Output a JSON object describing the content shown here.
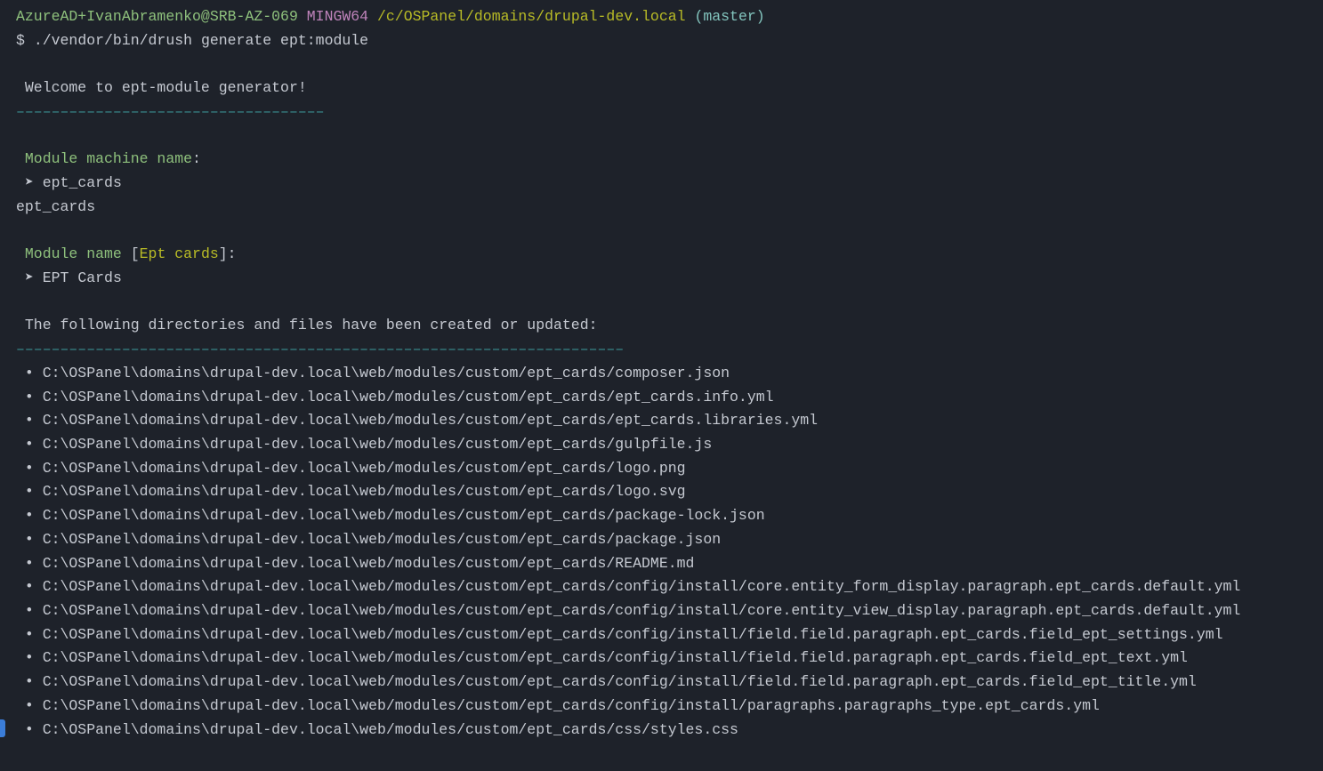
{
  "prompt": {
    "user_host": "AzureAD+IvanAbramenko@SRB-AZ-069",
    "shell": "MINGW64",
    "path": "/c/OSPanel/domains/drupal-dev.local",
    "branch": "(master)",
    "symbol": "$",
    "command": "./vendor/bin/drush generate ept:module"
  },
  "welcome": {
    "text": " Welcome to ept-module generator!",
    "dashes": "–––––––––––––––––––––––––––––––––––"
  },
  "machine_name": {
    "label": " Module machine name",
    "colon": ":",
    "arrow": " ➤ ",
    "input": "ept_cards",
    "echo": "ept_cards"
  },
  "module_name": {
    "label": " Module name",
    "bracket_open": " [",
    "default": "Ept cards",
    "bracket_close": "]:",
    "arrow": " ➤ ",
    "input": "EPT Cards"
  },
  "created": {
    "text": " The following directories and files have been created or updated:",
    "dashes": "–––––––––––––––––––––––––––––––––––––––––––––––––––––––––––––––––––––"
  },
  "files": [
    "C:\\OSPanel\\domains\\drupal-dev.local\\web/modules/custom/ept_cards/composer.json",
    "C:\\OSPanel\\domains\\drupal-dev.local\\web/modules/custom/ept_cards/ept_cards.info.yml",
    "C:\\OSPanel\\domains\\drupal-dev.local\\web/modules/custom/ept_cards/ept_cards.libraries.yml",
    "C:\\OSPanel\\domains\\drupal-dev.local\\web/modules/custom/ept_cards/gulpfile.js",
    "C:\\OSPanel\\domains\\drupal-dev.local\\web/modules/custom/ept_cards/logo.png",
    "C:\\OSPanel\\domains\\drupal-dev.local\\web/modules/custom/ept_cards/logo.svg",
    "C:\\OSPanel\\domains\\drupal-dev.local\\web/modules/custom/ept_cards/package-lock.json",
    "C:\\OSPanel\\domains\\drupal-dev.local\\web/modules/custom/ept_cards/package.json",
    "C:\\OSPanel\\domains\\drupal-dev.local\\web/modules/custom/ept_cards/README.md",
    "C:\\OSPanel\\domains\\drupal-dev.local\\web/modules/custom/ept_cards/config/install/core.entity_form_display.paragraph.ept_cards.default.yml",
    "C:\\OSPanel\\domains\\drupal-dev.local\\web/modules/custom/ept_cards/config/install/core.entity_view_display.paragraph.ept_cards.default.yml",
    "C:\\OSPanel\\domains\\drupal-dev.local\\web/modules/custom/ept_cards/config/install/field.field.paragraph.ept_cards.field_ept_settings.yml",
    "C:\\OSPanel\\domains\\drupal-dev.local\\web/modules/custom/ept_cards/config/install/field.field.paragraph.ept_cards.field_ept_text.yml",
    "C:\\OSPanel\\domains\\drupal-dev.local\\web/modules/custom/ept_cards/config/install/field.field.paragraph.ept_cards.field_ept_title.yml",
    "C:\\OSPanel\\domains\\drupal-dev.local\\web/modules/custom/ept_cards/config/install/paragraphs.paragraphs_type.ept_cards.yml",
    "C:\\OSPanel\\domains\\drupal-dev.local\\web/modules/custom/ept_cards/css/styles.css"
  ]
}
